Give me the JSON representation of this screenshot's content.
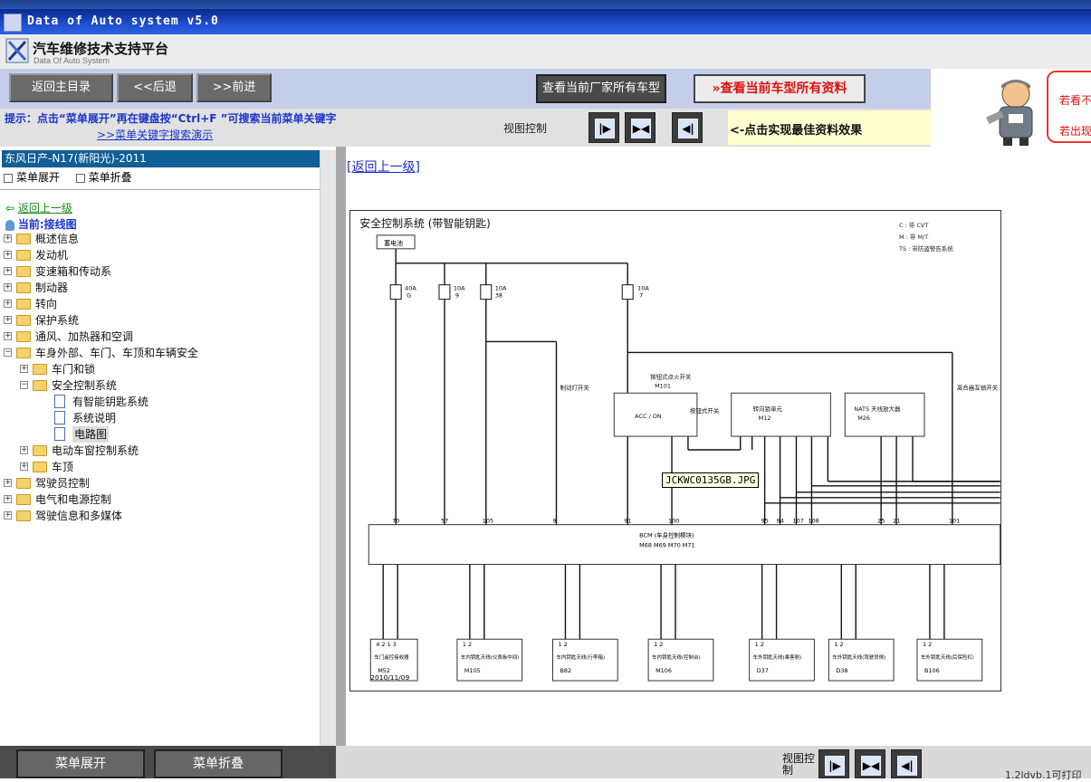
{
  "window": {
    "title": "Data of Auto system v5.0"
  },
  "header": {
    "title": "汽车维修技术支持平台",
    "subtitle": "Data Of Auto System"
  },
  "toolbar": {
    "home": "返回主目录",
    "back": "<<后退",
    "forward": ">>前进",
    "all_models": "查看当前厂家所有车型",
    "all_data": "查看当前车型所有资料"
  },
  "hint": {
    "text": "提示：点击“菜单展开”再在键盘按“Ctrl+F ”可搜索当前菜单关键字",
    "link": ">>菜单关键字搜索演示"
  },
  "view_control": {
    "label": "视图控制",
    "tip": "<-点击实现最佳资料效果"
  },
  "side_box": {
    "line1": "若看不",
    "line2": "若出现"
  },
  "left": {
    "model": "东风日产-N17(新阳光)-2011",
    "expand": "菜单展开",
    "collapse": "菜单折叠",
    "back": "返回上一级",
    "current": "当前:接线图",
    "tree": [
      {
        "label": "概述信息",
        "level": 0,
        "type": "folder"
      },
      {
        "label": "发动机",
        "level": 0,
        "type": "folder"
      },
      {
        "label": "变速箱和传动系",
        "level": 0,
        "type": "folder"
      },
      {
        "label": "制动器",
        "level": 0,
        "type": "folder"
      },
      {
        "label": "转向",
        "level": 0,
        "type": "folder"
      },
      {
        "label": "保护系统",
        "level": 0,
        "type": "folder"
      },
      {
        "label": "通风、加热器和空调",
        "level": 0,
        "type": "folder"
      },
      {
        "label": "车身外部、车门、车顶和车辆安全",
        "level": 0,
        "type": "folder-open"
      },
      {
        "label": "车门和锁",
        "level": 1,
        "type": "folder"
      },
      {
        "label": "安全控制系统",
        "level": 1,
        "type": "folder-open"
      },
      {
        "label": "有智能钥匙系统",
        "level": 2,
        "type": "doc"
      },
      {
        "label": "系统说明",
        "level": 2,
        "type": "doc"
      },
      {
        "label": "电路图",
        "level": 2,
        "type": "doc",
        "selected": true
      },
      {
        "label": "电动车窗控制系统",
        "level": 1,
        "type": "folder"
      },
      {
        "label": "车顶",
        "level": 1,
        "type": "folder"
      },
      {
        "label": "驾驶员控制",
        "level": 0,
        "type": "folder"
      },
      {
        "label": "电气和电源控制",
        "level": 0,
        "type": "folder"
      },
      {
        "label": "驾驶信息和多媒体",
        "level": 0,
        "type": "folder"
      }
    ]
  },
  "content": {
    "back_link": "[返回上一级]",
    "tooltip": "JCKWC0135GB.JPG"
  },
  "diagram": {
    "title": "安全控制系统 (带智能钥匙)",
    "legend": [
      "C : 带 CVT",
      "M : 带 M/T",
      "TS : 带防盗警告系统"
    ],
    "battery": "蓄电池",
    "fuses": [
      {
        "amp": "40A",
        "id": "G"
      },
      {
        "amp": "10A",
        "id": "9"
      },
      {
        "amp": "10A",
        "id": "38"
      },
      {
        "amp": "10A",
        "id": "7"
      }
    ],
    "labels": {
      "brake_switch": "制动灯开关",
      "push_switch": "按钮式点火开关",
      "push_switch_conn": "M101",
      "acc_on": "ACC / ON",
      "push_btn": "按钮式开关",
      "steer_lock": "转向锁单元",
      "steer_lock_conn": "M12",
      "nats": "NATS 天线放大器",
      "nats_conn": "M26",
      "clutch": "离合器互锁开关",
      "bcm": "BCM (车身控制模块)",
      "bcm_conns": "M68  M69  M70  M71",
      "date": "2010/11/09"
    },
    "bcm_pins_top": [
      "70",
      "57",
      "105",
      "9",
      "91",
      "100",
      "95",
      "94",
      "107",
      "108",
      "25",
      "21",
      "101"
    ],
    "components": [
      {
        "name": "车门遥控接收器",
        "conn": "M52",
        "pins": "4 2 1 3"
      },
      {
        "name": "车内钥匙天线(仪表板中间)",
        "conn": "M105",
        "pins": "1 2"
      },
      {
        "name": "车内钥匙天线(行李箱)",
        "conn": "B82",
        "pins": "1 2"
      },
      {
        "name": "车内钥匙天线(控制台)",
        "conn": "M106",
        "pins": "1 2"
      },
      {
        "name": "车外钥匙天线(乘客侧)",
        "conn": "D37",
        "pins": "1 2"
      },
      {
        "name": "车外钥匙天线(驾驶员侧)",
        "conn": "D38",
        "pins": "1 2"
      },
      {
        "name": "车外钥匙天线(后保险杠)",
        "conn": "B106",
        "pins": "1 2"
      }
    ]
  },
  "bottom": {
    "expand": "菜单展开",
    "collapse": "菜单折叠",
    "view_label": "视图控制",
    "cut_text": "1.2ldvb.1可打印"
  },
  "colors": {
    "title_bar": "#1f4fd0",
    "toolbar_bg": "#c4cde9",
    "model_bar": "#0e5f95",
    "hint_text": "#1c35c8",
    "tip_bg": "#ffffd0"
  }
}
